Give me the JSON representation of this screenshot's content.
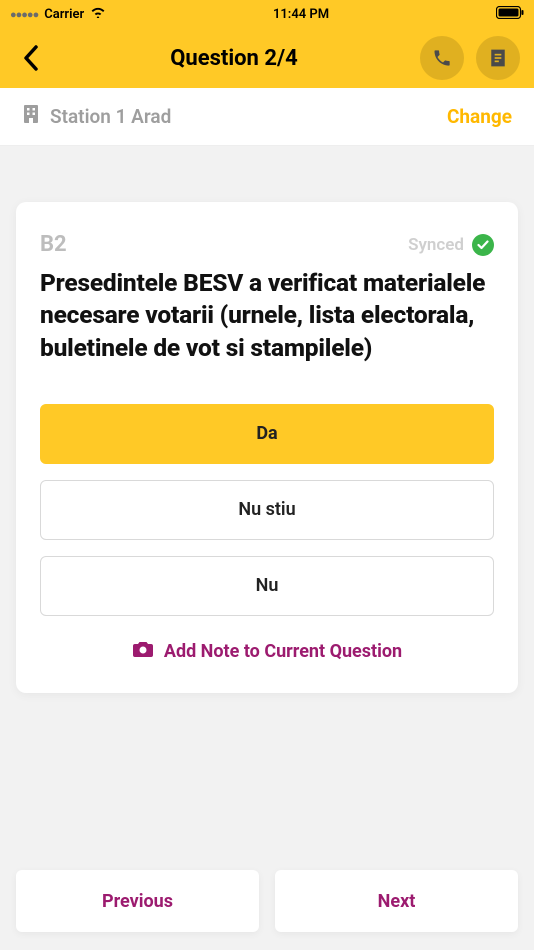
{
  "status": {
    "carrier": "Carrier",
    "time": "11:44 PM"
  },
  "header": {
    "title": "Question 2/4"
  },
  "station": {
    "name": "Station 1 Arad",
    "change": "Change"
  },
  "question": {
    "code": "B2",
    "sync_label": "Synced",
    "text": "Presedintele BESV a verificat materialele necesare votarii (urnele, lista electorala, buletinele de vot si stampilele)",
    "options": [
      {
        "label": "Da",
        "selected": true
      },
      {
        "label": "Nu stiu",
        "selected": false
      },
      {
        "label": "Nu",
        "selected": false
      }
    ],
    "add_note": "Add Note to Current Question"
  },
  "nav": {
    "prev": "Previous",
    "next": "Next"
  }
}
